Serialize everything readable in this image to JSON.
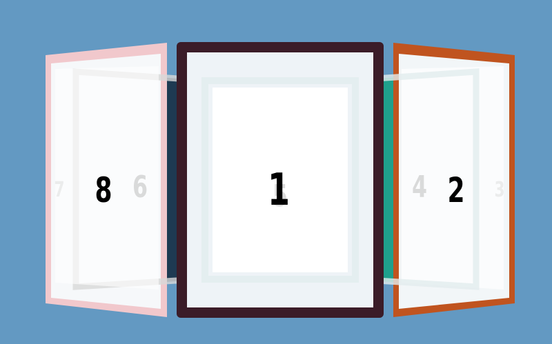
{
  "carousel": {
    "panels": [
      {
        "id": "front",
        "label": "1",
        "frame_color": "#3b1c28"
      },
      {
        "id": "left",
        "label": "8",
        "frame_color": "#f1c8cc"
      },
      {
        "id": "right",
        "label": "2",
        "frame_color": "#c0541f"
      },
      {
        "id": "back-left",
        "label": "6",
        "frame_color": "#1e3a52"
      },
      {
        "id": "back-right",
        "label": "4",
        "frame_color": "#1fa08c"
      },
      {
        "id": "back",
        "label": "5",
        "frame_color": "#e8f0f2"
      },
      {
        "id": "far-left",
        "label": "7",
        "frame_color": "#f1c8cc"
      },
      {
        "id": "far-right",
        "label": "3",
        "frame_color": "#c0541f"
      }
    ]
  }
}
